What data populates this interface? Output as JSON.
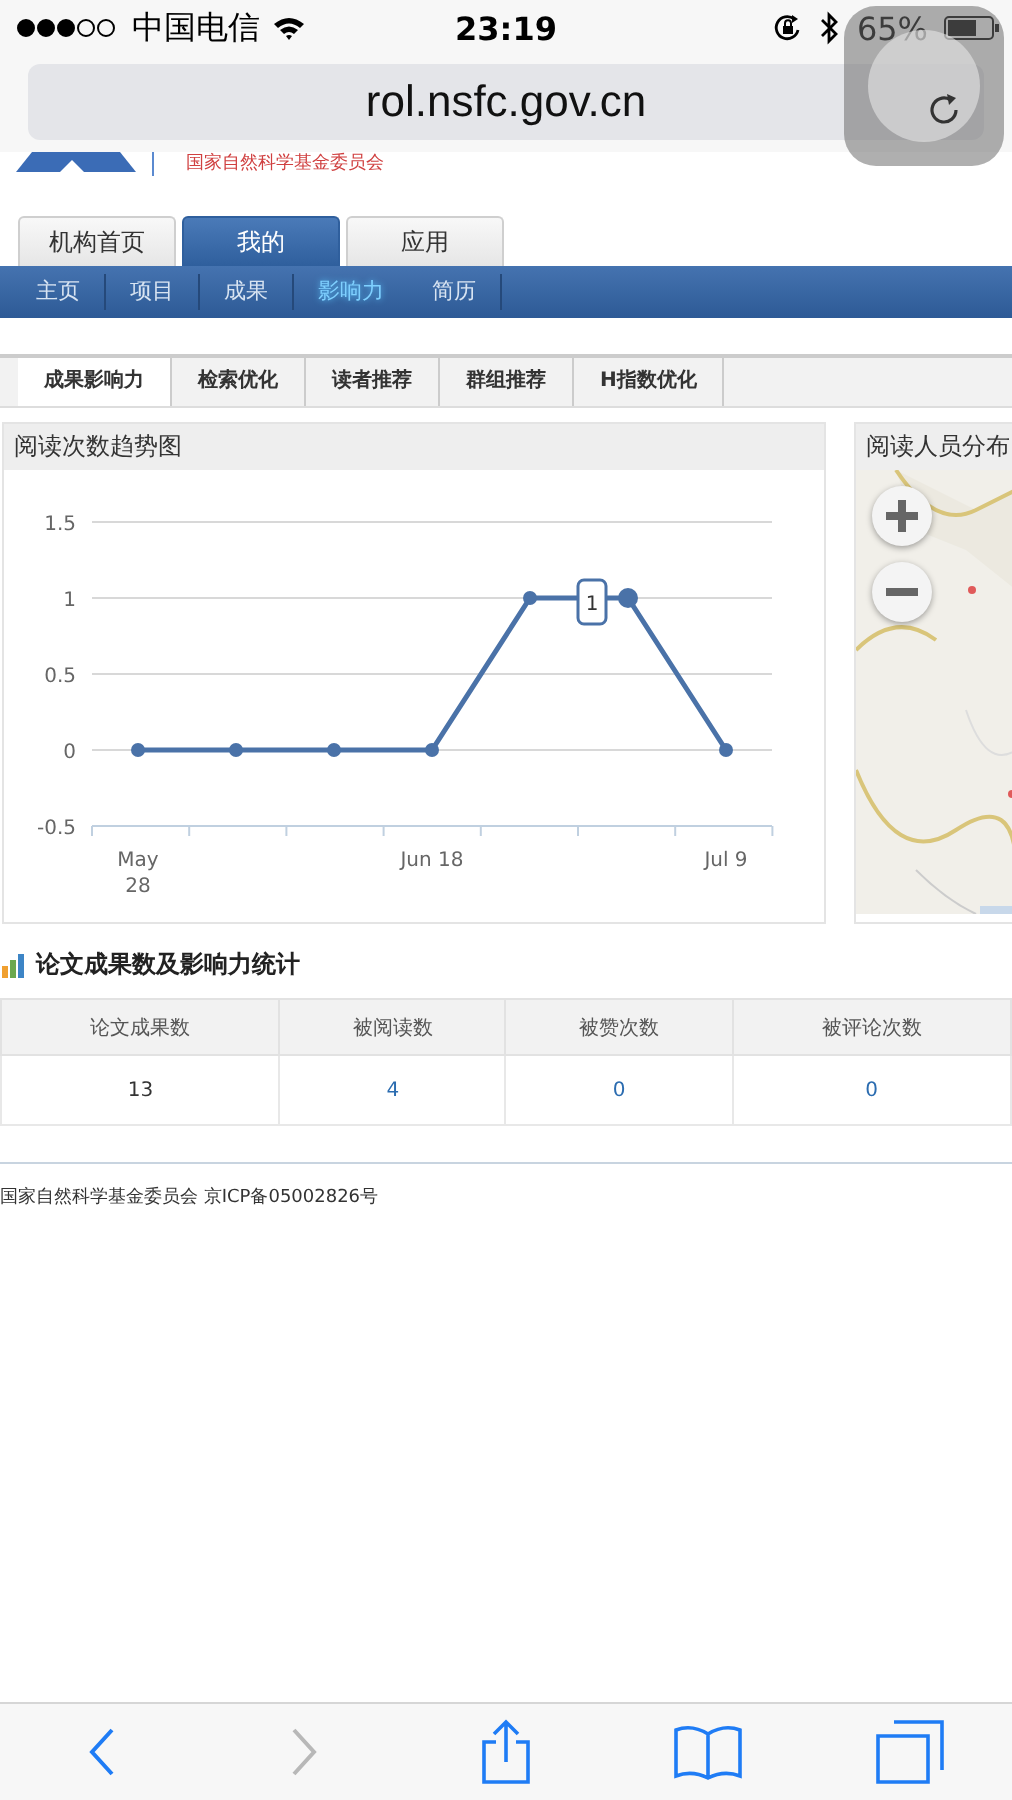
{
  "status_bar": {
    "carrier": "中国电信",
    "time": "23:19",
    "battery": "65%"
  },
  "address_bar": {
    "url": "rol.nsfc.gov.cn"
  },
  "site_header": {
    "org_name": "国家自然科学基金委员会"
  },
  "main_tabs": [
    {
      "label": "机构首页",
      "selected": false
    },
    {
      "label": "我的",
      "selected": true
    },
    {
      "label": "应用",
      "selected": false
    }
  ],
  "nav": [
    {
      "label": "主页",
      "selected": false
    },
    {
      "label": "项目",
      "selected": false
    },
    {
      "label": "成果",
      "selected": false
    },
    {
      "label": "影响力",
      "selected": true
    },
    {
      "label": "简历",
      "selected": false
    }
  ],
  "sub_tabs": [
    {
      "label": "成果影响力",
      "selected": true
    },
    {
      "label": "检索优化",
      "selected": false
    },
    {
      "label": "读者推荐",
      "selected": false
    },
    {
      "label": "群组推荐",
      "selected": false
    },
    {
      "label": "H指数优化",
      "selected": false
    }
  ],
  "trend_panel": {
    "title": "阅读次数趋势图",
    "chart_data": {
      "type": "line",
      "categories": [
        "May\n28",
        null,
        null,
        "Jun 18",
        null,
        null,
        "Jul 9"
      ],
      "series": [
        {
          "color": "#4a72a8",
          "marker": true,
          "values": [
            0,
            0,
            0,
            0,
            1,
            1,
            0
          ]
        }
      ],
      "ylim": [
        -0.5,
        1.5
      ],
      "yticks": [
        -0.5,
        0,
        0.5,
        1,
        1.5
      ],
      "grid": true,
      "annotations": [
        {
          "y": 1,
          "text": "1"
        }
      ]
    }
  },
  "map_panel": {
    "title": "阅读人员分布"
  },
  "stats": {
    "title": "论文成果数及影响力统计",
    "columns": [
      "论文成果数",
      "被阅读数",
      "被赞次数",
      "被评论次数"
    ],
    "rows": [
      [
        {
          "text": "13",
          "kind": "text"
        },
        {
          "text": "4",
          "kind": "link"
        },
        {
          "text": "0",
          "kind": "link"
        },
        {
          "text": "0",
          "kind": "link"
        }
      ]
    ]
  },
  "footer": {
    "text": "国家自然科学基金委员会 京ICP备05002826号"
  },
  "toolbar": [
    {
      "kind": "back",
      "disabled": false
    },
    {
      "kind": "forward",
      "disabled": true
    },
    {
      "kind": "share",
      "disabled": false
    },
    {
      "kind": "bookmarks",
      "disabled": false
    },
    {
      "kind": "tabs",
      "disabled": false
    }
  ]
}
